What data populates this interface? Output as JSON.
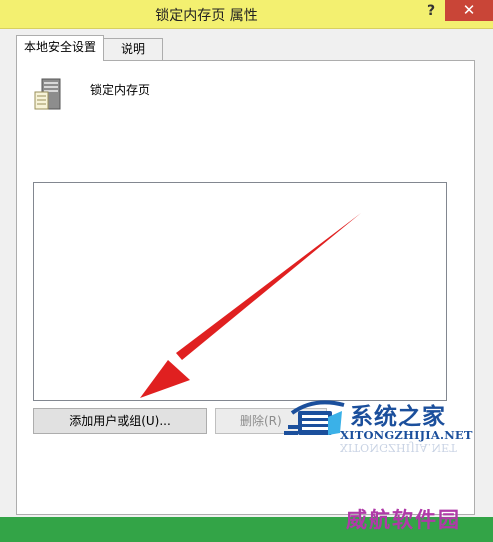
{
  "window": {
    "title": "锁定内存页 属性",
    "help_glyph": "?",
    "close_glyph": "✕"
  },
  "tabs": [
    {
      "label": "本地安全设置",
      "active": true
    },
    {
      "label": "说明",
      "active": false
    }
  ],
  "policy": {
    "name": "锁定内存页",
    "icon": "server-policy-icon"
  },
  "user_list": [],
  "buttons": {
    "add": "添加用户或组(U)...",
    "remove": "删除(R)"
  },
  "watermark": {
    "cn": "系统之家",
    "en": "XITONGZHIJIA.NET",
    "bottom": "威航软件园"
  },
  "colors": {
    "titlebar": "#f3f070",
    "close": "#c94537",
    "arrow": "#e02020",
    "bottom_bar": "#33a447"
  }
}
